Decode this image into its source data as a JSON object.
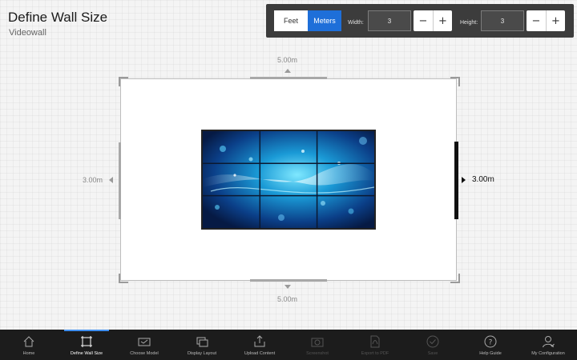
{
  "header": {
    "title": "Define Wall Size",
    "subtitle": "Videowall"
  },
  "toolbar": {
    "feet_label": "Feet",
    "meters_label": "Meters",
    "width_label": "Width:",
    "width_value": "3",
    "height_label": "Height:",
    "height_value": "3",
    "minus": "−",
    "plus": "+"
  },
  "wall": {
    "top_dimension": "5.00m",
    "bottom_dimension": "5.00m",
    "left_dimension": "3.00m",
    "right_dimension": "3.00m"
  },
  "bottom_nav": {
    "items": [
      {
        "label": "Home",
        "icon": "home-icon",
        "state": "normal"
      },
      {
        "label": "Define Wall Size",
        "icon": "crop-icon",
        "state": "active"
      },
      {
        "label": "Choose Model",
        "icon": "monitor-icon",
        "state": "normal"
      },
      {
        "label": "Display Layout",
        "icon": "layout-icon",
        "state": "normal"
      },
      {
        "label": "Upload Content",
        "icon": "upload-icon",
        "state": "normal"
      },
      {
        "label": "Screenshot",
        "icon": "camera-icon",
        "state": "disabled"
      },
      {
        "label": "Export to PDF",
        "icon": "pdf-icon",
        "state": "disabled"
      },
      {
        "label": "Save",
        "icon": "check-icon",
        "state": "disabled"
      },
      {
        "label": "Help Guide",
        "icon": "help-icon",
        "state": "normal"
      },
      {
        "label": "My Configuration",
        "icon": "user-icon",
        "state": "normal"
      }
    ]
  },
  "colors": {
    "accent": "#1e6fd9",
    "nav_active": "#3f8ff0",
    "toolbar_bg": "#3c3c3c",
    "nav_bg": "#1c1c1c"
  }
}
